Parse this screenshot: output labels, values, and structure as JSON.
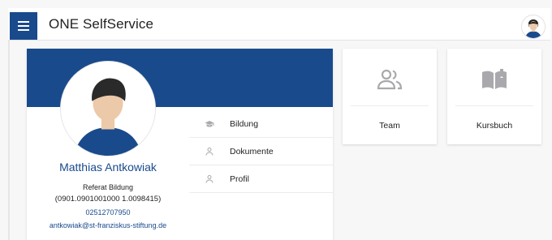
{
  "appbar": {
    "title": "ONE SelfService",
    "menu_icon": "hamburger-menu-icon",
    "avatar_icon": "user-avatar-icon"
  },
  "profile": {
    "name": "Matthias Antkowiak",
    "department": "Referat Bildung",
    "department_code": "(0901.0901001000 1.0098415)",
    "phone": "02512707950",
    "email": "antkowiak@st-franziskus-stiftung.de"
  },
  "profile_menu": [
    {
      "label": "Bildung",
      "icon": "graduation-cap-icon"
    },
    {
      "label": "Dokumente",
      "icon": "person-icon"
    },
    {
      "label": "Profil",
      "icon": "person-icon"
    }
  ],
  "tiles": [
    {
      "label": "Team",
      "icon": "team-icon"
    },
    {
      "label": "Kursbuch",
      "icon": "book-icon"
    }
  ],
  "colors": {
    "brand": "#194a8c",
    "background": "#f7f7f8",
    "icon_gray": "#a9a9ad"
  }
}
